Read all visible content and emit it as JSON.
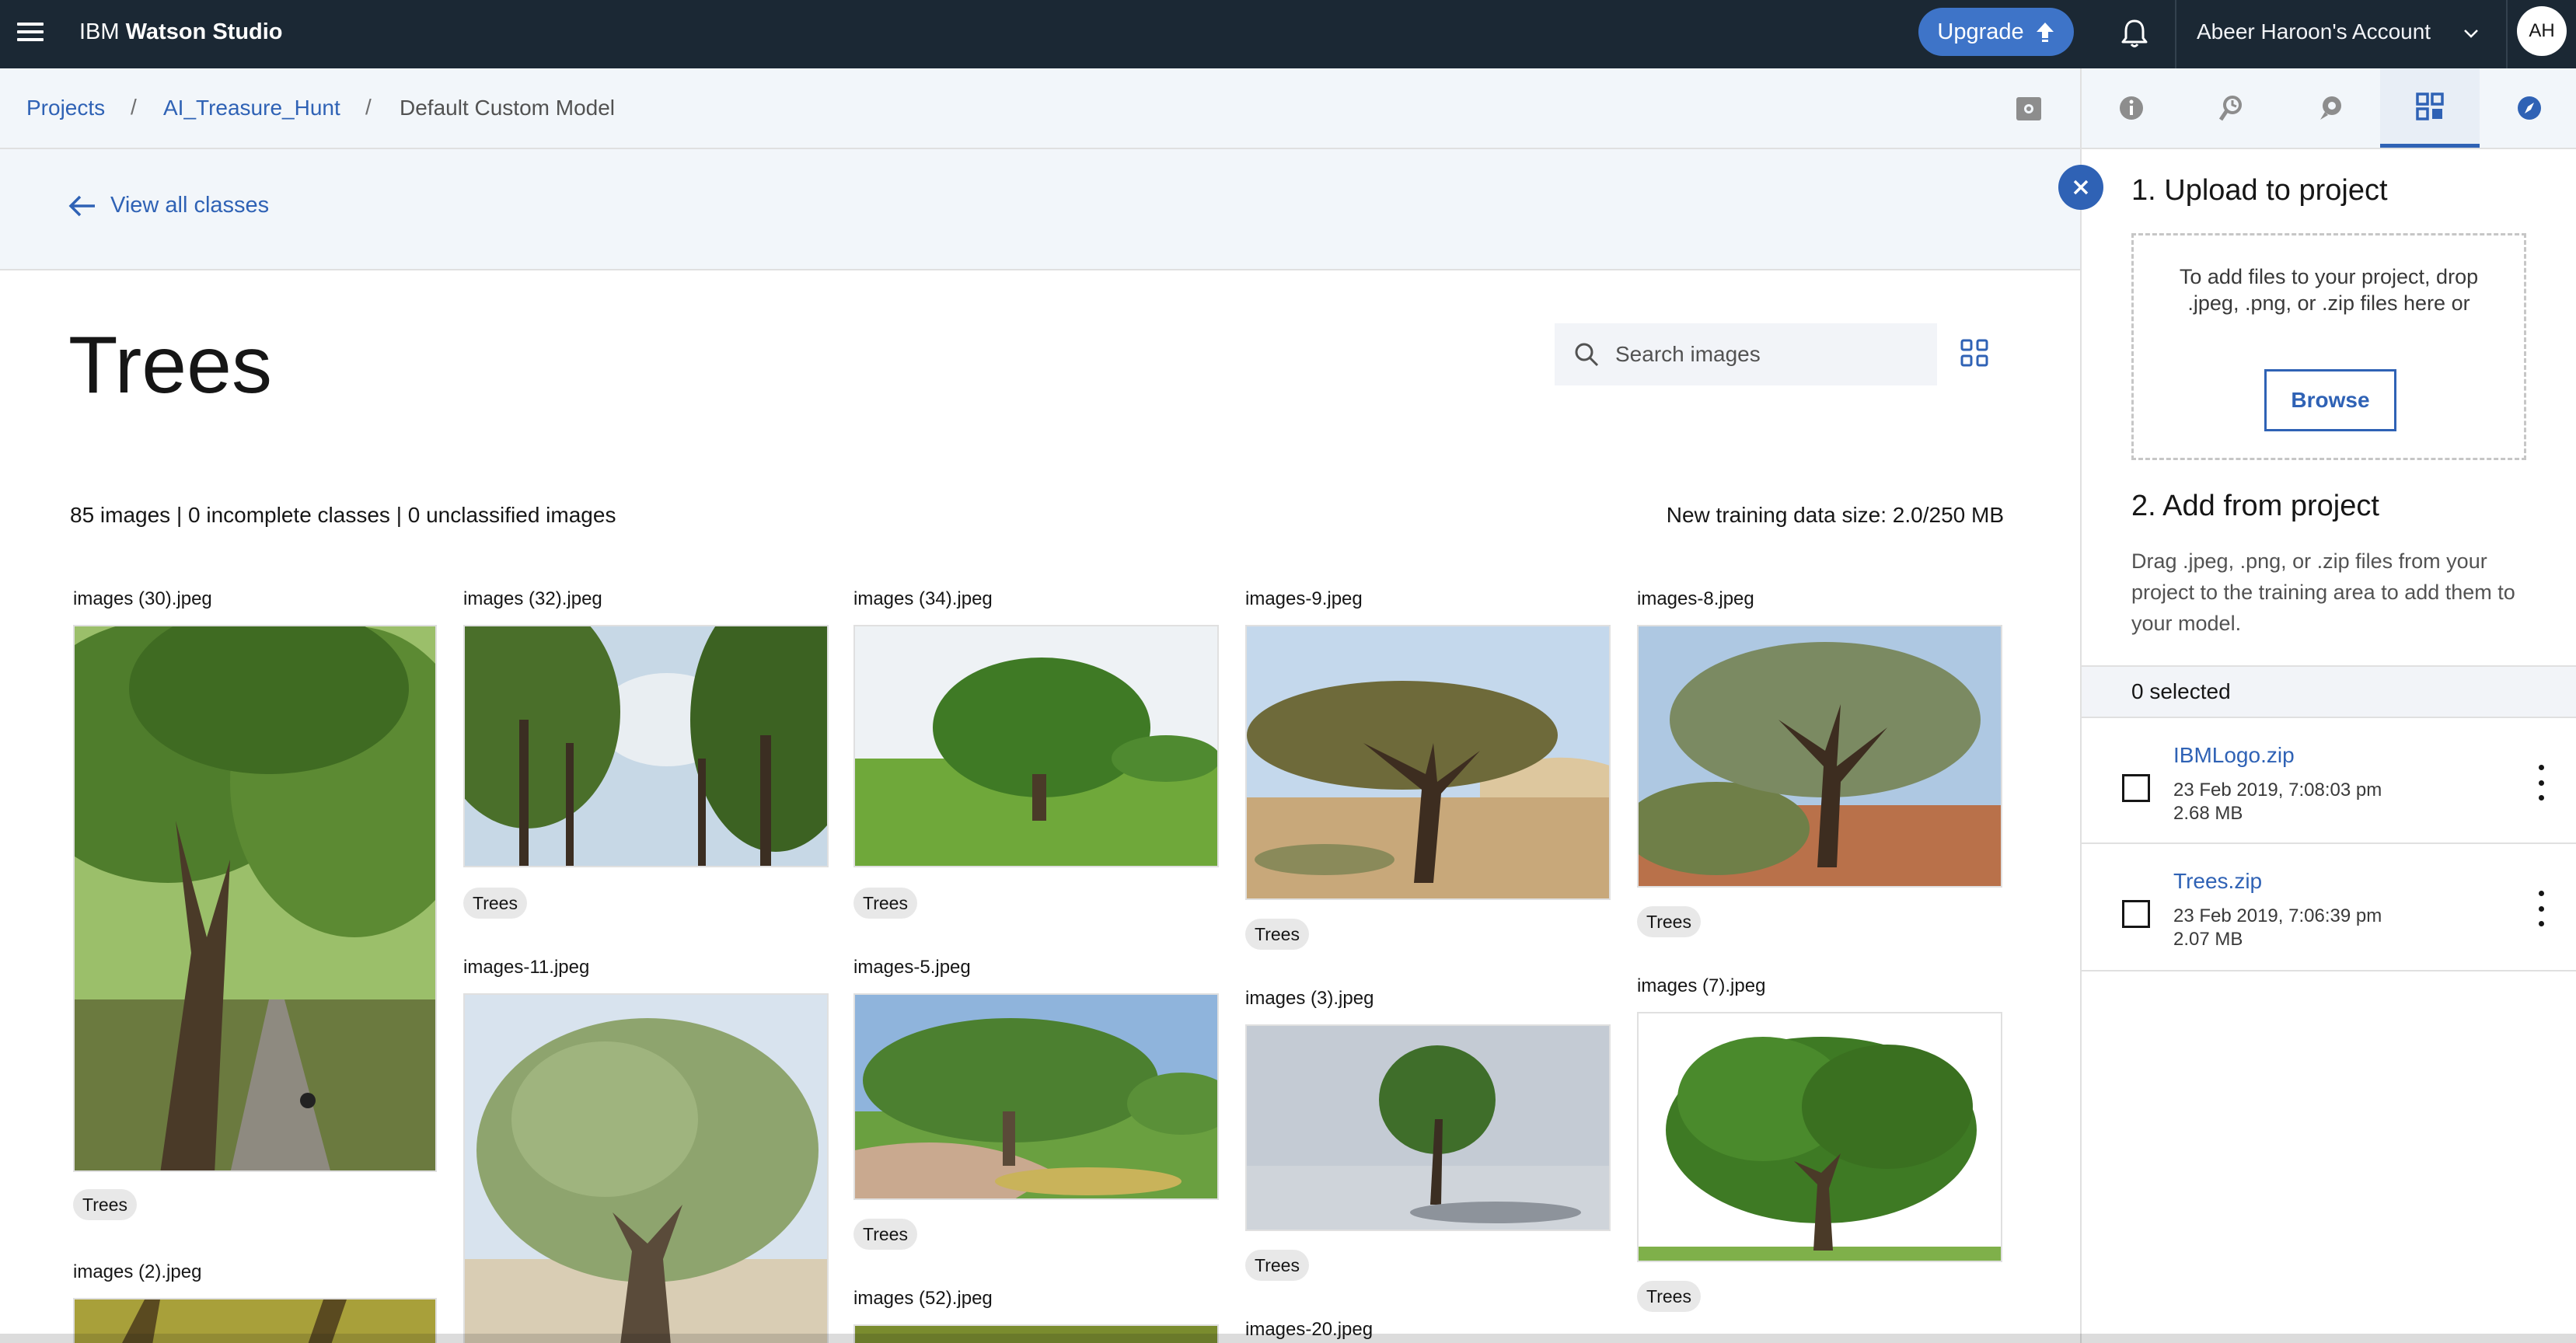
{
  "topbar": {
    "brand_prefix": "IBM",
    "brand_name": "Watson Studio",
    "upgrade_label": "Upgrade",
    "account_label": "Abeer Haroon's Account",
    "avatar_initials": "AH"
  },
  "breadcrumb": {
    "items": [
      "Projects",
      "AI_Treasure_Hunt",
      "Default Custom Model"
    ],
    "separator": "/"
  },
  "back_link": "View all classes",
  "page": {
    "title": "Trees",
    "search_placeholder": "Search images",
    "stats": "85 images | 0 incomplete classes | 0 unclassified images",
    "training_size": "New training data size: 2.0/250 MB"
  },
  "images": [
    {
      "filename": "images (30).jpeg",
      "tag": "Trees"
    },
    {
      "filename": "images (2).jpeg",
      "tag": ""
    },
    {
      "filename": "images (32).jpeg",
      "tag": "Trees"
    },
    {
      "filename": "images-11.jpeg",
      "tag": ""
    },
    {
      "filename": "images (34).jpeg",
      "tag": "Trees"
    },
    {
      "filename": "images-5.jpeg",
      "tag": "Trees"
    },
    {
      "filename": "images (52).jpeg",
      "tag": ""
    },
    {
      "filename": "images-9.jpeg",
      "tag": "Trees"
    },
    {
      "filename": "images (3).jpeg",
      "tag": "Trees"
    },
    {
      "filename": "images-20.jpeg",
      "tag": ""
    },
    {
      "filename": "images-8.jpeg",
      "tag": "Trees"
    },
    {
      "filename": "images (7).jpeg",
      "tag": "Trees"
    }
  ],
  "panel": {
    "upload_heading": "1. Upload to project",
    "dropzone_text": "To add files to your project, drop .jpeg, .png, or .zip files here or",
    "browse_label": "Browse",
    "add_heading": "2. Add from project",
    "add_text": "Drag .jpeg, .png, or .zip files from your project to the training area to add them to your model.",
    "selected_text": "0 selected",
    "files": [
      {
        "name": "IBMLogo.zip",
        "date": "23 Feb 2019, 7:08:03 pm",
        "size": "2.68 MB"
      },
      {
        "name": "Trees.zip",
        "date": "23 Feb 2019, 7:06:39 pm",
        "size": "2.07 MB"
      }
    ]
  },
  "icons": {
    "menu": "hamburger-icon",
    "upgrade": "upload-arrow-icon",
    "notifications": "bell-icon",
    "account_dropdown": "chevron-down-icon",
    "back": "arrow-left-icon",
    "search": "search-icon",
    "view_toggle": "grid-view-icon",
    "close": "close-icon",
    "rail": [
      "info-icon",
      "asset-history-icon",
      "chat-icon",
      "data-assets-icon",
      "compass-icon"
    ]
  },
  "colors": {
    "topbar_bg": "#1b2834",
    "accent_blue": "#2f62b5",
    "upgrade_bg": "#3e74c8",
    "light_band": "#f2f6fa",
    "tag_bg": "#e8e8e8"
  }
}
